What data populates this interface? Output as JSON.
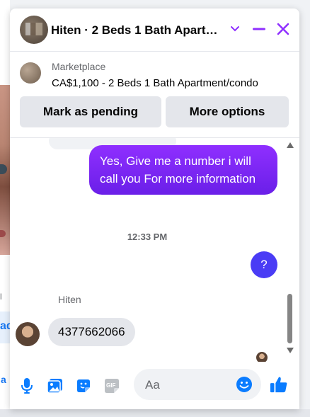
{
  "colors": {
    "accent": "#8f2fff",
    "outgoing": "#6a1fe8",
    "messenger_blue": "#0a7cff",
    "secondary": "#e4e6eb"
  },
  "header": {
    "title": "Hiten · 2 Beds 1 Bath Apart…",
    "icons": [
      "chevron-down-icon",
      "minimize-icon",
      "close-icon"
    ]
  },
  "listing": {
    "label": "Marketplace",
    "title": "CA$1,100 - 2 Beds 1 Bath Apartment/condo",
    "buttons": {
      "pending": "Mark as pending",
      "more": "More options"
    }
  },
  "messages": {
    "outgoing_text": "Yes, Give me a number i will call you For more information",
    "timestamp": "12:33 PM",
    "outgoing_question": "?",
    "sender_name": "Hiten",
    "incoming_text": "4377662066"
  },
  "composer": {
    "placeholder": "Aa",
    "icons": [
      "microphone-icon",
      "photo-icon",
      "sticker-icon",
      "gif-icon",
      "emoji-icon",
      "thumbs-up-icon"
    ],
    "gif_label": "GIF"
  },
  "background": {
    "fragment_1": "ad",
    "fragment_2": "a"
  }
}
